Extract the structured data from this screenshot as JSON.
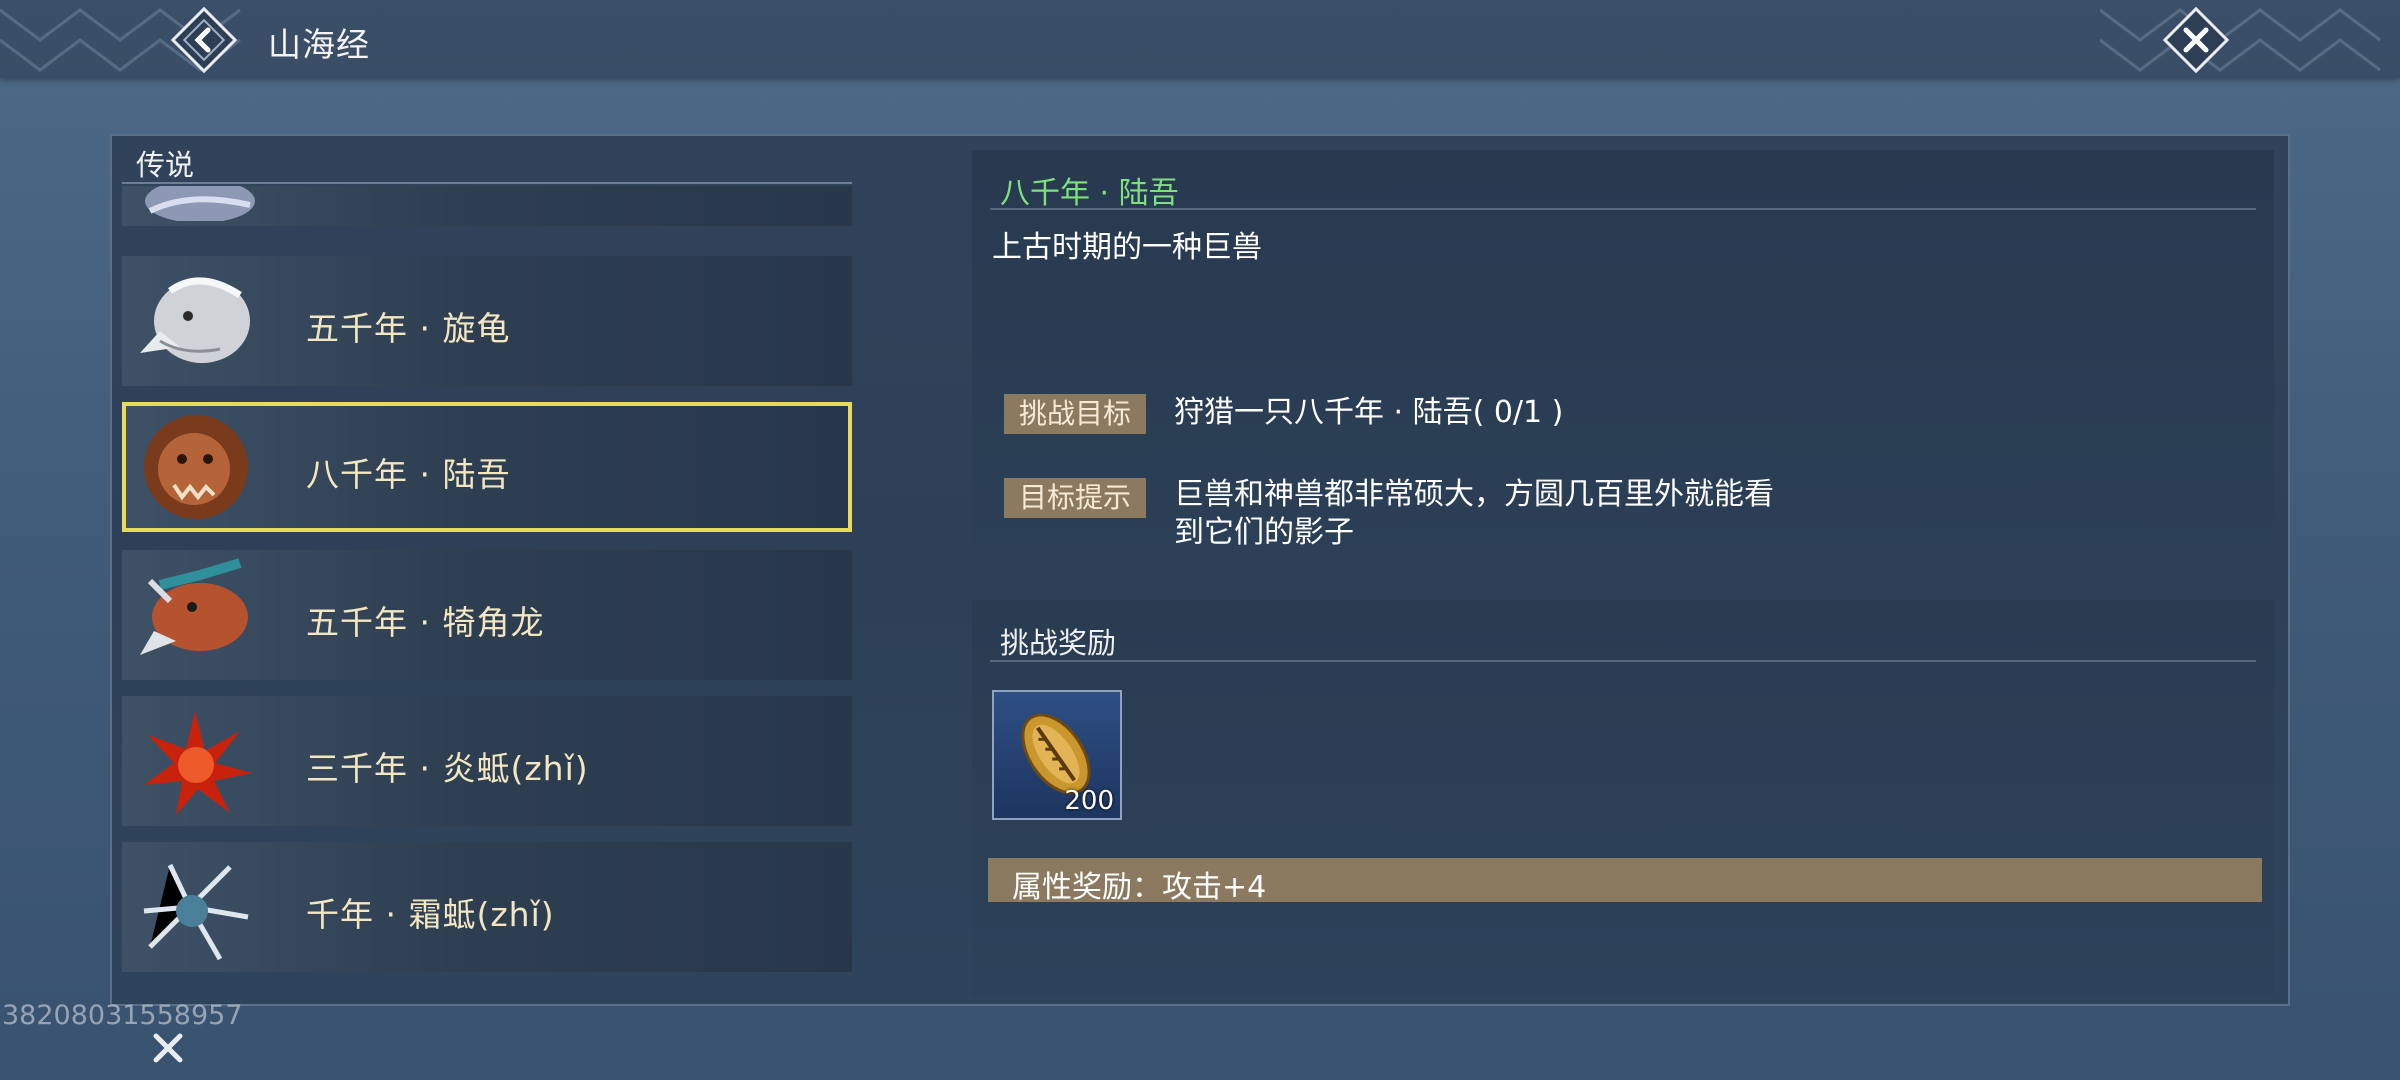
{
  "header": {
    "title": "山海经",
    "back_icon": "chevron-left-diamond-icon",
    "close_icon": "close-diamond-icon"
  },
  "list": {
    "section_label": "传说",
    "items": [
      {
        "label": "",
        "portrait": "bird-beast-portrait"
      },
      {
        "label": "五千年 · 旋龟",
        "portrait": "white-beast-portrait"
      },
      {
        "label": "八千年 · 陆吾",
        "portrait": "lion-beast-portrait"
      },
      {
        "label": "五千年 · 犄角龙",
        "portrait": "horned-dragon-portrait"
      },
      {
        "label": "三千年 · 炎蚳(zhǐ)",
        "portrait": "flame-creature-portrait"
      },
      {
        "label": "千年 · 霜蚳(zhǐ)",
        "portrait": "frost-creature-portrait"
      }
    ],
    "selected_index": 2
  },
  "detail": {
    "title": "八千年 · 陆吾",
    "description": "上古时期的一种巨兽",
    "goal_tag": "挑战目标",
    "goal_text": "狩猎一只八千年 · 陆吾( 0/1 )",
    "hint_tag": "目标提示",
    "hint_line1": "巨兽和神兽都非常硕大，方圆几百里外就能看",
    "hint_line2": "到它们的影子"
  },
  "reward": {
    "label": "挑战奖励",
    "item_count": "200",
    "item_icon": "shell-coin-icon",
    "attribute_text": "属性奖励：攻击+4"
  },
  "footer": {
    "watermark": "38208031558957",
    "close_icon": "close-icon"
  },
  "colors": {
    "selected_border": "#e9db5a",
    "title_green": "#7ee07e",
    "tag_bg": "#8b7a60"
  }
}
